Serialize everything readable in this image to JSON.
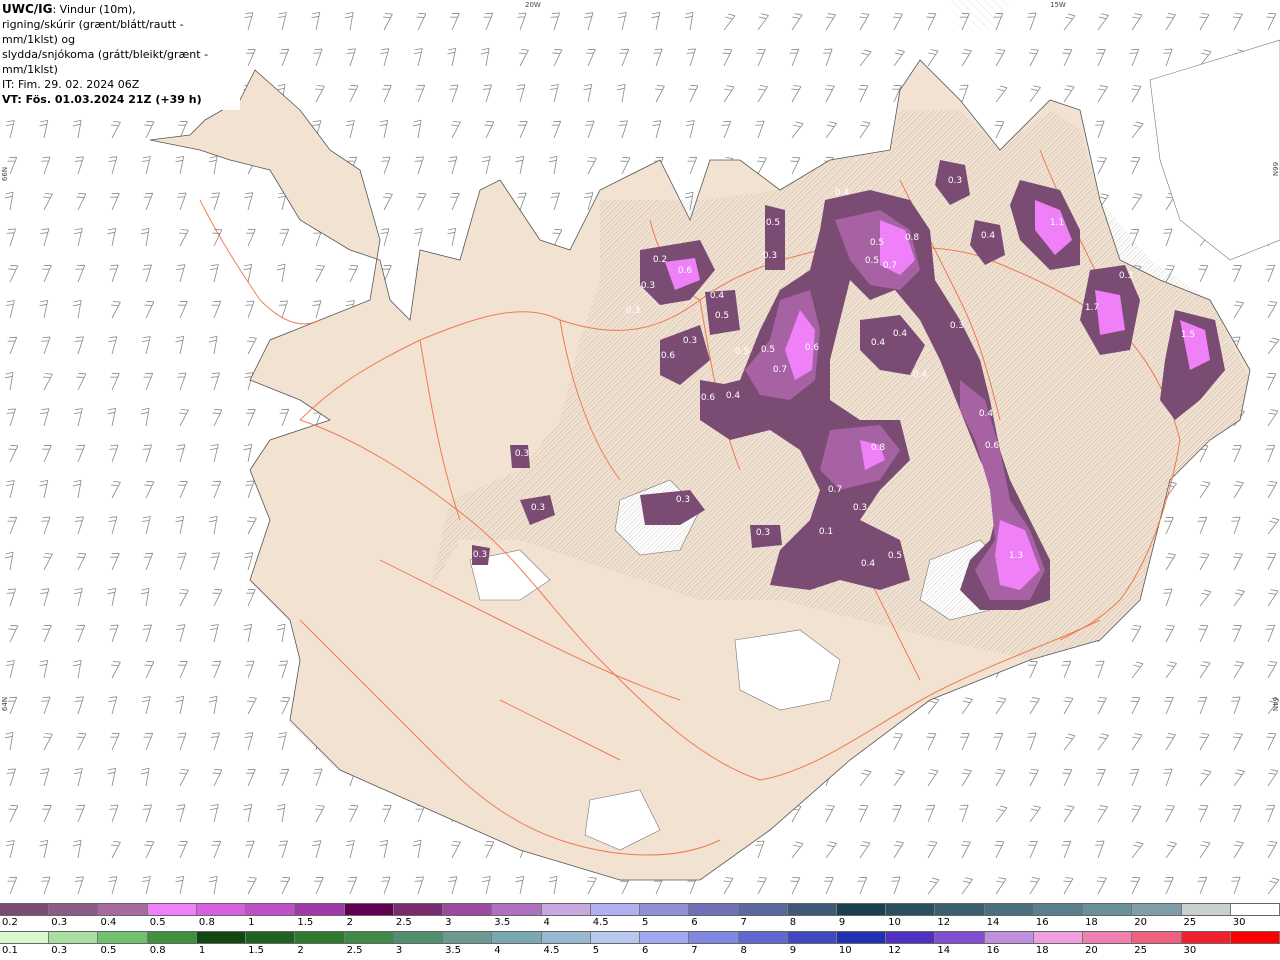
{
  "header": {
    "line1_bold": "UWC/IG",
    "line1_rest": ": Vindur (10m),",
    "line2": "rigning/skúrir (grænt/blátt/rautt - mm/1klst) og",
    "line3": "slydda/snjókoma (grátt/bleikt/grænt - mm/1klst)",
    "line4": "IT: Fim. 29. 02. 2024 06Z",
    "line5": "VT: Fös. 01.03.2024 21Z (+39 h)"
  },
  "coords": {
    "top_20w": "20W",
    "top_15w": "15W",
    "left_66n": "66N",
    "left_64n": "64N",
    "right_66n": "66N",
    "right_64n": "64N"
  },
  "colors": {
    "land": "#f2e2d2",
    "sea": "#ffffff",
    "roads": "#ee6a3c",
    "snow_light": "#8c5a86",
    "snow_mid": "#b050c0",
    "snow_high": "#f080f8"
  },
  "precip_values": [
    {
      "v": "0.4"
    },
    {
      "v": "0.3"
    },
    {
      "v": "1.1"
    },
    {
      "v": "0.5"
    },
    {
      "v": "0.5"
    },
    {
      "v": "0.8"
    },
    {
      "v": "0.5"
    },
    {
      "v": "0.7"
    },
    {
      "v": "0.4"
    },
    {
      "v": "0.3"
    },
    {
      "v": "0.2"
    },
    {
      "v": "0.6"
    },
    {
      "v": "0.3"
    },
    {
      "v": "0.4"
    },
    {
      "v": "0.5"
    },
    {
      "v": "0.3"
    },
    {
      "v": "1.7"
    },
    {
      "v": "0.3"
    },
    {
      "v": "1.5"
    },
    {
      "v": "0.3"
    },
    {
      "v": "0.6"
    },
    {
      "v": "0.5"
    },
    {
      "v": "0.5"
    },
    {
      "v": "0.6"
    },
    {
      "v": "0.7"
    },
    {
      "v": "0.4"
    },
    {
      "v": "0.4"
    },
    {
      "v": "0.4"
    },
    {
      "v": "0.6"
    },
    {
      "v": "0.3"
    },
    {
      "v": "0.4"
    },
    {
      "v": "0.8"
    },
    {
      "v": "0.6"
    },
    {
      "v": "0.4"
    },
    {
      "v": "0.3"
    },
    {
      "v": "0.3"
    },
    {
      "v": "0.3"
    },
    {
      "v": "0.7"
    },
    {
      "v": "0.3"
    },
    {
      "v": "0.3"
    },
    {
      "v": "0.1"
    },
    {
      "v": "0.5"
    },
    {
      "v": "0.4"
    },
    {
      "v": "1.3"
    },
    {
      "v": "0.3"
    }
  ],
  "legend_snow": {
    "labels": [
      "0.2",
      "0.3",
      "0.4",
      "0.5",
      "0.8",
      "1",
      "1.5",
      "2",
      "2.5",
      "3",
      "3.5",
      "4",
      "4.5",
      "5",
      "6",
      "7",
      "8",
      "9",
      "10",
      "12",
      "14",
      "16",
      "18",
      "20",
      "25",
      "30"
    ],
    "colors": [
      "#7a4c74",
      "#8c5a86",
      "#a76aa0",
      "#f080f8",
      "#d860e0",
      "#c050c8",
      "#a03aa8",
      "#600050",
      "#7a2a70",
      "#9a4aa0",
      "#b070c0",
      "#c8a8e0",
      "#b0b0f0",
      "#9090d8",
      "#7070b8",
      "#5a6aa0",
      "#405878",
      "#1a4050",
      "#2a5060",
      "#3a6070",
      "#4a7080",
      "#5a8090",
      "#6a9098",
      "#809ea8",
      "#c8d0d0",
      "#ffffff"
    ]
  },
  "legend_rain": {
    "labels": [
      "0.1",
      "0.3",
      "0.5",
      "0.8",
      "1",
      "1.5",
      "2",
      "2.5",
      "3",
      "3.5",
      "4",
      "4.5",
      "5",
      "6",
      "7",
      "8",
      "9",
      "10",
      "12",
      "14",
      "16",
      "18",
      "20",
      "25",
      "30",
      ""
    ],
    "colors": [
      "#d8f8d0",
      "#a8e0a0",
      "#70c070",
      "#409040",
      "#104810",
      "#206020",
      "#307a30",
      "#408a48",
      "#509070",
      "#6a9a90",
      "#7aa8b0",
      "#9ab8d0",
      "#b8c8f0",
      "#a0a8f0",
      "#8088e0",
      "#6068d0",
      "#4048c0",
      "#2030b0",
      "#5030c0",
      "#8050d0",
      "#c090e0",
      "#f0a0e0",
      "#f080b0",
      "#f06080",
      "#f02030",
      "#ff0000"
    ]
  }
}
